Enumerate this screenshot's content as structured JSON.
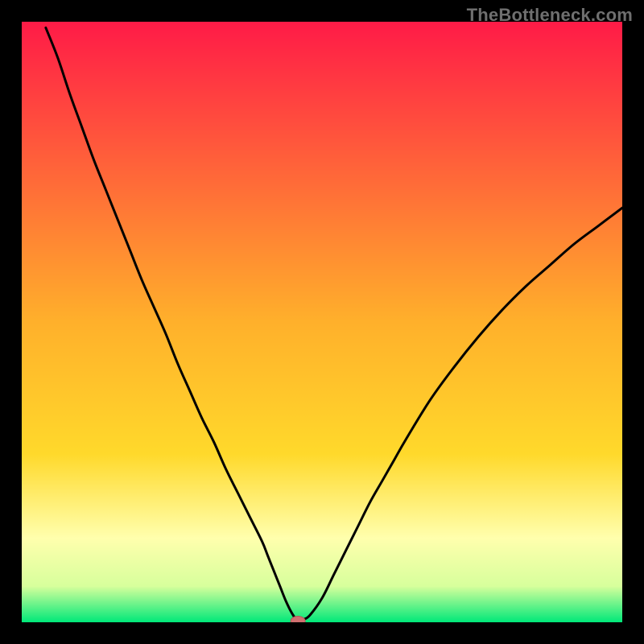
{
  "watermark": "TheBottleneck.com",
  "colors": {
    "frame": "#000000",
    "gradient_top": "#ff1b47",
    "gradient_mid": "#ffd92b",
    "gradient_pale_band": "#ffffad",
    "gradient_bottom_green": "#00e879",
    "curve": "#000000",
    "marker_fill": "#d07070",
    "marker_stroke": "#b05858"
  },
  "chart_data": {
    "type": "line",
    "title": "",
    "xlabel": "",
    "ylabel": "",
    "xlim": [
      0,
      100
    ],
    "ylim": [
      0,
      100
    ],
    "x": [
      4,
      6,
      8,
      10,
      12,
      14,
      16,
      18,
      20,
      22,
      24,
      26,
      28,
      30,
      32,
      34,
      36,
      38,
      40,
      41,
      42,
      43,
      44,
      45,
      46,
      47,
      48,
      50,
      52,
      54,
      56,
      58,
      60,
      62,
      64,
      68,
      72,
      76,
      80,
      84,
      88,
      92,
      96,
      100
    ],
    "values": [
      99,
      94,
      88,
      82.5,
      77,
      72,
      67,
      62,
      57,
      52.5,
      48,
      43,
      38.5,
      34,
      30,
      25.5,
      21.5,
      17.5,
      13.5,
      11,
      8.5,
      6,
      3.5,
      1.5,
      0.2,
      0.5,
      1.2,
      4,
      8,
      12,
      16,
      20,
      23.5,
      27,
      30.5,
      37,
      42.5,
      47.5,
      52,
      56,
      59.5,
      63,
      66,
      69
    ],
    "series": [
      {
        "name": "bottleneck-curve",
        "x_ref": "x",
        "y_ref": "values"
      }
    ],
    "marker": {
      "x": 46,
      "y": 0.2
    },
    "annotations": [],
    "grid": false,
    "legend": null
  }
}
